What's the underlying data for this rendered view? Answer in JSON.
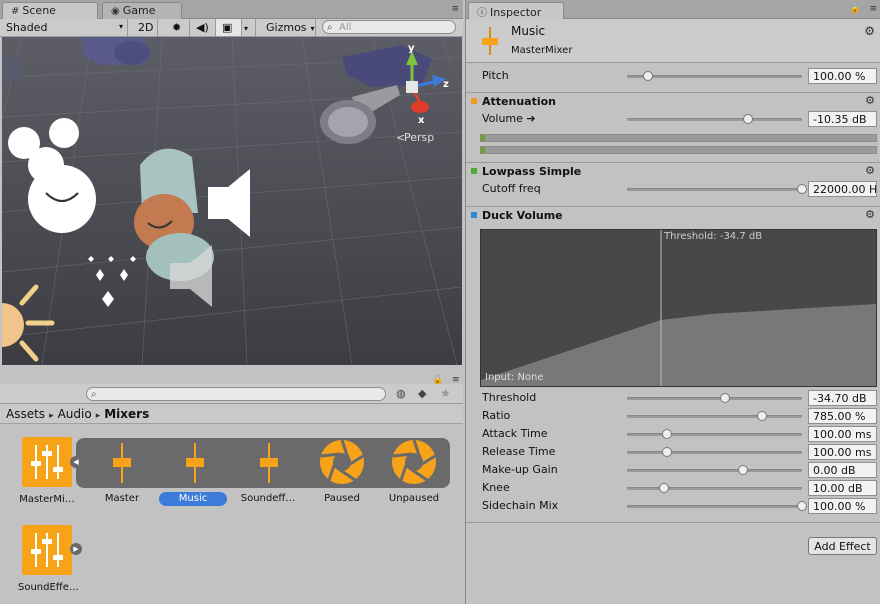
{
  "scene": {
    "tabs": [
      {
        "label": "Scene",
        "icon": "scene-grid-icon"
      },
      {
        "label": "Game",
        "icon": "game-controller-icon"
      }
    ],
    "toolbar": {
      "shading_mode": "Shaded",
      "mode_2d": "2D",
      "gizmos": "Gizmos",
      "search_placeholder": "All"
    },
    "persp_label": "Persp",
    "gizmo_axes": [
      "y",
      "z",
      "x"
    ]
  },
  "project": {
    "breadcrumb": [
      "Assets",
      "Audio",
      "Mixers"
    ],
    "assets": [
      {
        "name": "MasterMi…"
      },
      {
        "name": "SoundEffe…"
      }
    ],
    "snapshots": [
      {
        "name": "Master",
        "icon": "fader-icon"
      },
      {
        "name": "Music",
        "icon": "fader-icon",
        "selected": true
      },
      {
        "name": "Soundeff…",
        "icon": "fader-icon"
      },
      {
        "name": "Paused",
        "icon": "snapshot-aperture-icon"
      },
      {
        "name": "Unpaused",
        "icon": "snapshot-aperture-icon"
      }
    ]
  },
  "inspector": {
    "tab": "Inspector",
    "header": {
      "title": "Music",
      "subtitle": "MasterMixer"
    },
    "pitch": {
      "label": "Pitch",
      "value": "100.00 %",
      "level": 0.12
    },
    "attenuation": {
      "title": "Attenuation",
      "color": "#f29a1e",
      "volume": {
        "label": "Volume ➔",
        "value": "-10.35 dB",
        "level": 0.69
      },
      "meters": [
        0.01,
        0.01
      ]
    },
    "lowpass": {
      "title": "Lowpass Simple",
      "color": "#53a837",
      "cutoff": {
        "label": "Cutoff freq",
        "value": "22000.00 H",
        "level": 1.0
      }
    },
    "duck": {
      "title": "Duck Volume",
      "color": "#2f8ad0",
      "graph_threshold": "Threshold: -34.7 dB",
      "graph_input": "Input: None",
      "params": [
        {
          "label": "Threshold",
          "value": "-34.70 dB",
          "level": 0.56
        },
        {
          "label": "Ratio",
          "value": "785.00 %",
          "level": 0.77
        },
        {
          "label": "Attack Time",
          "value": "100.00 ms",
          "level": 0.23
        },
        {
          "label": "Release Time",
          "value": "100.00 ms",
          "level": 0.23
        },
        {
          "label": "Make-up Gain",
          "value": "0.00 dB",
          "level": 0.66
        },
        {
          "label": "Knee",
          "value": "10.00 dB",
          "level": 0.21
        },
        {
          "label": "Sidechain Mix",
          "value": "100.00 %",
          "level": 1.0
        }
      ]
    },
    "add_effect": "Add Effect"
  }
}
